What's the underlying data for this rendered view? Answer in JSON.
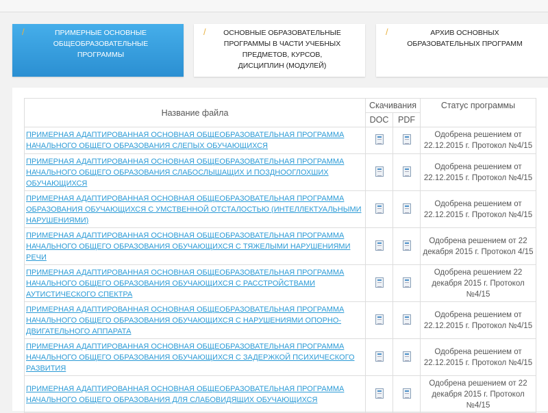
{
  "tabs": [
    {
      "label": "ПРИМЕРНЫЕ ОСНОВНЫЕ ОБЩЕОБРАЗОВАТЕЛЬНЫЕ ПРОГРАММЫ"
    },
    {
      "label": "ОСНОВНЫЕ ОБРАЗОВАТЕЛЬНЫЕ ПРОГРАММЫ В ЧАСТИ УЧЕБНЫХ ПРЕДМЕТОВ, КУРСОВ, ДИСЦИПЛИН (МОДУЛЕЙ)"
    },
    {
      "label": "АРХИВ ОСНОВНЫХ ОБРАЗОВАТЕЛЬНЫХ ПРОГРАММ"
    }
  ],
  "tab_marker": "/",
  "table": {
    "headers": {
      "name": "Название файла",
      "downloads": "Скачивания",
      "doc": "DOC",
      "pdf": "PDF",
      "status": "Статус программы"
    },
    "rows": [
      {
        "name": "ПРИМЕРНАЯ АДАПТИРОВАННАЯ ОСНОВНАЯ ОБЩЕОБРАЗОВАТЕЛЬНАЯ ПРОГРАММА НАЧАЛЬНОГО ОБЩЕГО ОБРАЗОВАНИЯ СЛЕПЫХ ОБУЧАЮЩИХСЯ",
        "status": "Одобрена решением от 22.12.2015 г. Протокол №4/15"
      },
      {
        "name": "ПРИМЕРНАЯ АДАПТИРОВАННАЯ ОСНОВНАЯ ОБЩЕОБРАЗОВАТЕЛЬНАЯ ПРОГРАММА НАЧАЛЬНОГО ОБЩЕГО ОБРАЗОВАНИЯ СЛАБОСЛЫШАЩИХ И ПОЗДНООГЛОХШИХ ОБУЧАЮЩИХСЯ",
        "status": "Одобрена решением от 22.12.2015 г. Протокол №4/15"
      },
      {
        "name": "ПРИМЕРНАЯ АДАПТИРОВАННАЯ ОСНОВНАЯ ОБЩЕОБРАЗОВАТЕЛЬНАЯ ПРОГРАММА ОБРАЗОВАНИЯ ОБУЧАЮЩИХСЯ С УМСТВЕННОЙ ОТСТАЛОСТЬЮ (ИНТЕЛЛЕКТУАЛЬНЫМИ НАРУШЕНИЯМИ)",
        "status": "Одобрена решением от 22.12.2015 г. Протокол №4/15"
      },
      {
        "name": "ПРИМЕРНАЯ АДАПТИРОВАННАЯ ОСНОВНАЯ ОБЩЕОБРАЗОВАТЕЛЬНАЯ ПРОГРАММА НАЧАЛЬНОГО ОБЩЕГО ОБРАЗОВАНИЯ ОБУЧАЮЩИХСЯ С ТЯЖЕЛЫМИ НАРУШЕНИЯМИ РЕЧИ",
        "status": "Одобрена решением от 22 декабря 2015 г. Протокол 4/15"
      },
      {
        "name": "ПРИМЕРНАЯ АДАПТИРОВАННАЯ ОСНОВНАЯ ОБЩЕОБРАЗОВАТЕЛЬНАЯ ПРОГРАММА НАЧАЛЬНОГО ОБЩЕГО ОБРАЗОВАНИЯ ОБУЧАЮЩИХСЯ С РАССТРОЙСТВАМИ АУТИСТИЧЕСКОГО СПЕКТРА",
        "status": "Одобрена решением 22 декабря 2015 г. Протокол №4/15"
      },
      {
        "name": "ПРИМЕРНАЯ АДАПТИРОВАННАЯ ОСНОВНАЯ ОБЩЕОБРАЗОВАТЕЛЬНАЯ ПРОГРАММА НАЧАЛЬНОГО ОБЩЕГО ОБРАЗОВАНИЯ ОБУЧАЮЩИХСЯ С НАРУШЕНИЯМИ ОПОРНО-ДВИГАТЕЛЬНОГО АППАРАТА",
        "status": "Одобрена решением от 22.12.2015 г. Протокол №4/15"
      },
      {
        "name": "ПРИМЕРНАЯ АДАПТИРОВАННАЯ ОСНОВНАЯ ОБЩЕОБРАЗОВАТЕЛЬНАЯ ПРОГРАММА НАЧАЛЬНОГО ОБЩЕГО ОБРАЗОВАНИЯ ОБУЧАЮЩИХСЯ С ЗАДЕРЖКОЙ ПСИХИЧЕСКОГО РАЗВИТИЯ",
        "status": "Одобрена решением от 22.12.2015 г. Протокол №4/15"
      },
      {
        "name": "ПРИМЕРНАЯ АДАПТИРОВАННАЯ ОСНОВНАЯ ОБЩЕОБРАЗОВАТЕЛЬНАЯ ПРОГРАММА НАЧАЛЬНОГО ОБЩЕГО ОБРАЗОВАНИЯ ДЛЯ СЛАБОВИДЯЩИХ ОБУЧАЮЩИХСЯ",
        "status": "Одобрена решением от 22 декабря 2015 г. Протокол №4/15"
      }
    ]
  }
}
